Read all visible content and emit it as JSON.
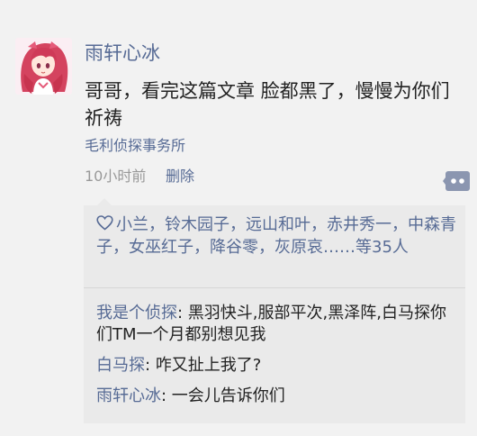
{
  "post": {
    "author": "雨轩心冰",
    "content": "哥哥，看完这篇文章 脸都黑了，慢慢为你们祈祷",
    "source": "毛利侦探事务所",
    "time": "10小时前",
    "delete_label": "删除"
  },
  "likes": {
    "text": "小兰，铃木园子，远山和叶，赤井秀一，中森青子，女巫红子，降谷零，灰原哀……等35人"
  },
  "comments": [
    {
      "name": "我是个侦探",
      "text": ": 黑羽快斗,服部平次,黑泽阵,白马探你们TM一个月都别想见我"
    },
    {
      "name": "白马探",
      "text": ": 咋又扯上我了?"
    },
    {
      "name": "雨轩心冰",
      "text": ": 一会儿告诉你们"
    }
  ],
  "colors": {
    "link": "#576b95",
    "background": "#f2f2f2",
    "panel": "#eaeaea"
  },
  "icons": {
    "avatar": "anime-girl-avatar",
    "like": "heart-outline-icon",
    "more": "more-dots-icon"
  }
}
